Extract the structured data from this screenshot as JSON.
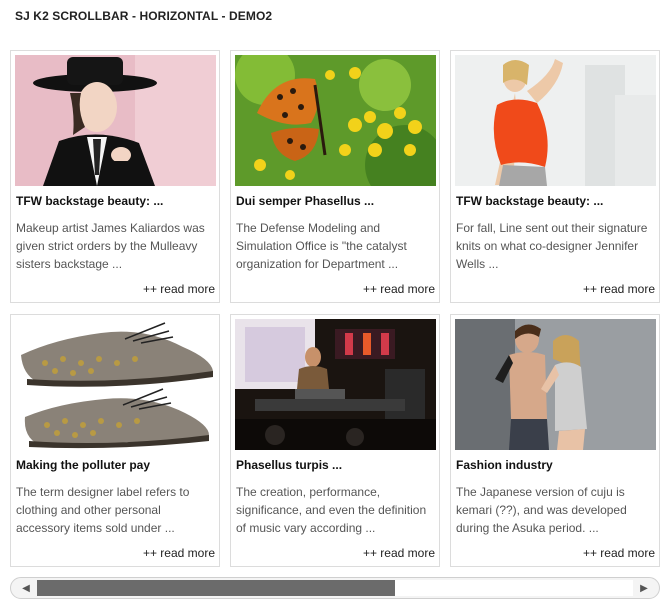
{
  "module": {
    "title": "SJ K2 SCROLLBAR - HORIZONTAL - DEMO2"
  },
  "items": [
    {
      "title": "TFW backstage beauty: ...",
      "desc": "Makeup artist James Kaliardos was given strict orders by the Mulleavy sisters backstage ...",
      "more": "++ read more",
      "image": "model-hat-image"
    },
    {
      "title": "Dui semper Phasellus ...",
      "desc": "The Defense Modeling and Simulation Office is \"the catalyst organization for Department ...",
      "more": "++ read more",
      "image": "butterfly-image"
    },
    {
      "title": "TFW backstage beauty: ...",
      "desc": "For fall, Line sent out their signature knits on what co-designer Jennifer Wells ...",
      "more": "++ read more",
      "image": "model-orange-top-image"
    },
    {
      "title": "Making the polluter pay",
      "desc": "The term designer label refers to clothing and other personal accessory items sold under ...",
      "more": "++ read more",
      "image": "studded-shoes-image"
    },
    {
      "title": "Phasellus turpis ...",
      "desc": "The creation, performance, significance, and even the definition of music vary according ...",
      "more": "++ read more",
      "image": "concert-stage-image"
    },
    {
      "title": "Fashion industry",
      "desc": "The Japanese version of cuju is kemari (??), and was developed during the Asuka period. ...",
      "more": "++ read more",
      "image": "couple-fashion-image"
    }
  ],
  "scrollbar": {
    "left_arrow": "◀",
    "right_arrow": "▶",
    "position": 0.0,
    "visible_fraction": 0.6
  }
}
